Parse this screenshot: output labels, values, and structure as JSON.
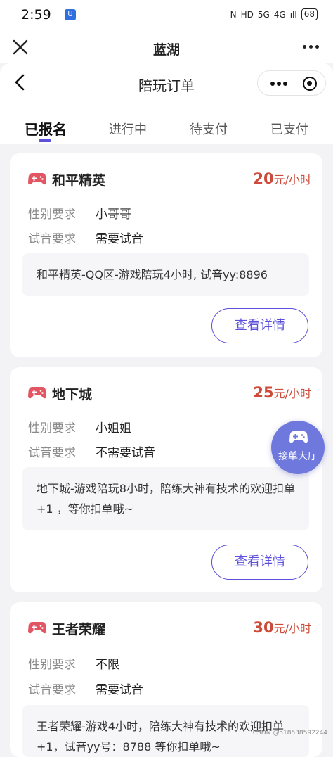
{
  "status_bar": {
    "time": "2:59",
    "badge": "U",
    "indicators": [
      "N",
      "HD",
      "5G",
      "4G",
      "ıll"
    ],
    "battery": "68"
  },
  "wx_bar": {
    "title": "蓝湖"
  },
  "page": {
    "title": "陪玩订单"
  },
  "tabs": [
    {
      "label": "已报名",
      "active": true
    },
    {
      "label": "进行中",
      "active": false
    },
    {
      "label": "待支付",
      "active": false
    },
    {
      "label": "已支付",
      "active": false
    }
  ],
  "labels": {
    "gender": "性别要求",
    "voice": "试音要求",
    "detail_button": "查看详情"
  },
  "orders": [
    {
      "title": "和平精英",
      "price": "20",
      "unit": "元/小时",
      "gender": "小哥哥",
      "voice": "需要试音",
      "desc": "和平精英-QQ区-游戏陪玩4小时, 试音yy:8896"
    },
    {
      "title": "地下城",
      "price": "25",
      "unit": "元/小时",
      "gender": "小姐姐",
      "voice": "不需要试音",
      "desc": "地下城-游戏陪玩8小时，陪练大神有技术的欢迎扣单+1 ，等你扣单哦~"
    },
    {
      "title": "王者荣耀",
      "price": "30",
      "unit": "元/小时",
      "gender": "不限",
      "voice": "需要试音",
      "desc": "王者荣耀-游戏4小时，陪练大神有技术的欢迎扣单+1，试音yy号：8788 等你扣单哦~"
    }
  ],
  "float_button": {
    "label": "接单大厅"
  },
  "watermark": "CSDN @h18538592244",
  "colors": {
    "accent": "#5b4fdb",
    "price": "#cc4b3a",
    "icon": "#e25563",
    "float": "#6f78dd"
  }
}
